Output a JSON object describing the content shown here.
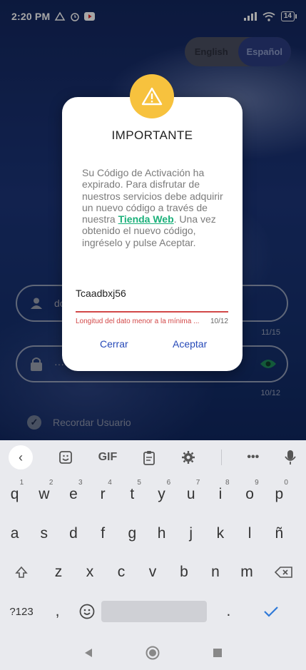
{
  "status_bar": {
    "time": "2:20 PM",
    "battery": "14"
  },
  "language_toggle": {
    "options": [
      "English",
      "Español"
    ],
    "selected": "Español"
  },
  "login_form": {
    "user_value": "do",
    "user_counter": "11/15",
    "password_value": "····",
    "password_counter": "10/12",
    "remember_label": "Recordar Usuario"
  },
  "dialog": {
    "title": "IMPORTANTE",
    "body_before_link": "Su Código de Activación ha expirado. Para disfrutar de nuestros servicios debe adquirir un nuevo código a través de nuestra ",
    "link_text": "Tienda Web",
    "body_after_link": ". Una vez obtenido el nuevo código, ingréselo y pulse Aceptar.",
    "code_value": "Tcaadbxj56",
    "error_message": "Longitud del dato menor a la mínima ...",
    "code_counter": "10/12",
    "cancel_label": "Cerrar",
    "accept_label": "Aceptar"
  },
  "keyboard": {
    "toolbar": [
      "back",
      "sticker",
      "GIF",
      "clipboard",
      "settings",
      "more",
      "mic"
    ],
    "gif_label": "GIF",
    "row1": [
      {
        "k": "q",
        "n": "1"
      },
      {
        "k": "w",
        "n": "2"
      },
      {
        "k": "e",
        "n": "3"
      },
      {
        "k": "r",
        "n": "4"
      },
      {
        "k": "t",
        "n": "5"
      },
      {
        "k": "y",
        "n": "6"
      },
      {
        "k": "u",
        "n": "7"
      },
      {
        "k": "i",
        "n": "8"
      },
      {
        "k": "o",
        "n": "9"
      },
      {
        "k": "p",
        "n": "0"
      }
    ],
    "row2": [
      "a",
      "s",
      "d",
      "f",
      "g",
      "h",
      "j",
      "k",
      "l",
      "ñ"
    ],
    "row3": [
      "z",
      "x",
      "c",
      "v",
      "b",
      "n",
      "m"
    ],
    "symbols_label": "?123",
    "comma_label": ",",
    "period_label": "."
  },
  "colors": {
    "accent_blue": "#2649b8",
    "warning_yellow": "#f7c23e",
    "error_red": "#d24848",
    "link_green": "#1bb07a"
  }
}
